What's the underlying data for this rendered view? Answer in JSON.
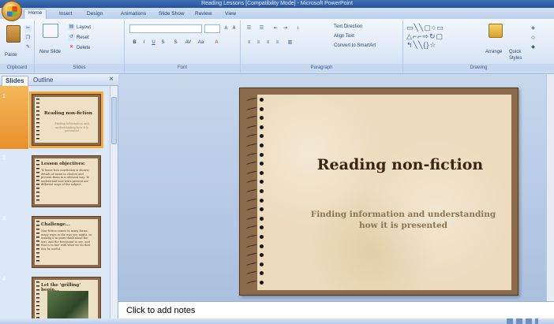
{
  "window": {
    "title": "Reading Lessons [Compatibility Mode] - Microsoft PowerPoint"
  },
  "ribbon_tabs": [
    {
      "label": "Home"
    },
    {
      "label": "Insert"
    },
    {
      "label": "Design"
    },
    {
      "label": "Animations"
    },
    {
      "label": "Slide Show"
    },
    {
      "label": "Review"
    },
    {
      "label": "View"
    }
  ],
  "ribbon": {
    "clipboard": {
      "paste": "Paste",
      "label": "Clipboard"
    },
    "slides": {
      "new_slide": "New Slide",
      "layout": "Layout",
      "reset": "Reset",
      "delete": "Delete",
      "label": "Slides"
    },
    "font": {
      "label": "Font"
    },
    "paragraph": {
      "text_direction": "Text Direction",
      "align_text": "Align Text",
      "convert_smartart": "Convert to SmartArt",
      "label": "Paragraph"
    },
    "drawing": {
      "arrange": "Arrange",
      "quick_styles": "Quick Styles",
      "label": "Drawing"
    }
  },
  "left_pane": {
    "tabs": [
      "Slides",
      "Outline"
    ],
    "close": "×",
    "thumbnails": [
      {
        "num": "1",
        "title": "Reading non-fiction",
        "body": "Finding information and understanding how it is presented"
      },
      {
        "num": "2",
        "title": "Lesson objectives:",
        "body": "To know how non-fiction is shown; details of mean in choices and present them in a relevant way. To understand how texts present are different ways of the subject."
      },
      {
        "num": "3",
        "title": "Challenge...",
        "body": "Non-fiction comes in many forms, many ways in the way you might, so making it in pairs think aloud the text, and the best point to see, and that is in line with what we do that this be useful."
      },
      {
        "num": "4",
        "title": "Let the 'grilling' begin...",
        "body": ""
      }
    ]
  },
  "slide": {
    "title": "Reading non-fiction",
    "subtitle": "Finding information and understanding how it is presented"
  },
  "notes": {
    "placeholder": "Click to add notes"
  }
}
